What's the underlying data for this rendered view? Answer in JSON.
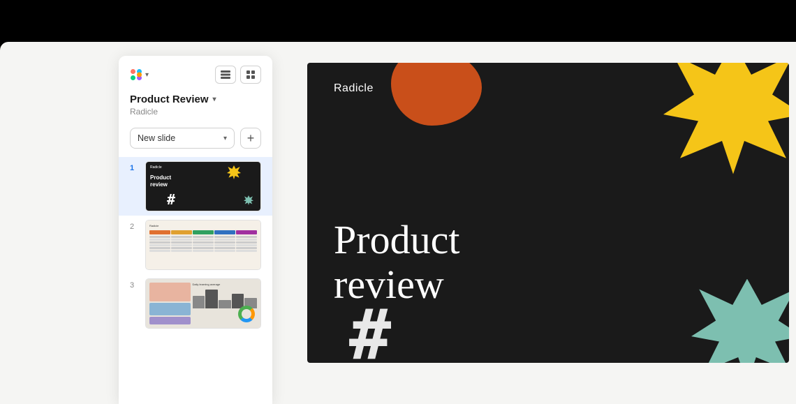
{
  "app": {
    "title": "Figma",
    "background": "#000"
  },
  "toolbar": {
    "app_icon": "figma-icon",
    "chevron": "▾",
    "view_list_label": "list-view",
    "view_grid_label": "grid-view"
  },
  "sidebar": {
    "project_title": "Product Review",
    "project_subtitle": "Radicle",
    "chevron": "▾",
    "new_slide_label": "New slide",
    "new_slide_chevron": "▾",
    "plus_label": "+",
    "slides": [
      {
        "number": "1",
        "brand": "Radicle",
        "title": "Product review",
        "active": true
      },
      {
        "number": "2",
        "brand": "Radicle",
        "active": false
      },
      {
        "number": "3",
        "brand": "Daily learning average",
        "active": false
      }
    ]
  },
  "canvas": {
    "brand": "Radicle",
    "title_line1": "Product",
    "title_line2": "review",
    "slide_bg": "#1a1a1a"
  }
}
